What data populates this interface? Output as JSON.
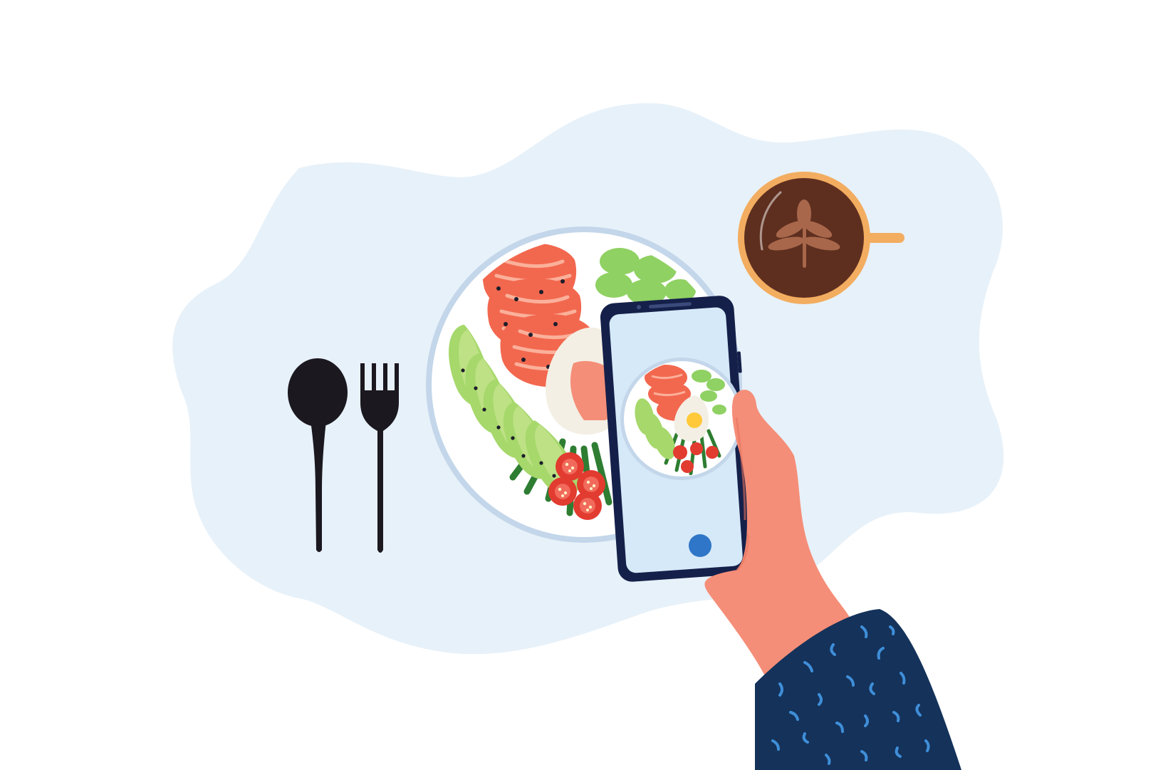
{
  "scene": {
    "subject": "food-photo-illustration",
    "colors": {
      "background": "#ffffff",
      "blob": "#e7f1f9",
      "plate_rim": "#c3d6ea",
      "plate": "#ffffff",
      "salmon": "#f2684f",
      "salmon_stripe": "#fbb09a",
      "avocado": "#a6d86b",
      "avocado_inner": "#d2ea9a",
      "cucumber": "#8fd162",
      "egg_white": "#f3efe4",
      "egg_yolk": "#ffc93a",
      "tomato": "#e23b30",
      "greens": "#2e7d32",
      "coffee": "#5e2f1f",
      "cup_rim": "#f3ad60",
      "latte_art": "#a8674b",
      "cutlery": "#1b1820",
      "phone_body": "#15204a",
      "phone_screen": "#d5e9f8",
      "shutter": "#2f76c8",
      "skin": "#f58e78",
      "skin_shade": "#e8735d",
      "sleeve": "#14325a",
      "sleeve_pattern": "#3f8ed8"
    },
    "icons": [
      "spoon-icon",
      "fork-icon",
      "coffee-cup-icon",
      "smartphone-icon",
      "camera-shutter-icon",
      "hand-icon"
    ]
  }
}
